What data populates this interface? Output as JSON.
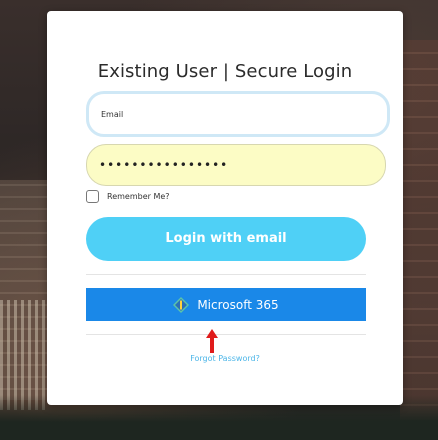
{
  "login": {
    "title": "Existing User | Secure Login",
    "email_placeholder": "Email",
    "password_mask": "••••••••••••••••",
    "remember_label": "Remember Me?",
    "login_button_label": "Login with email",
    "microsoft_button_label": "Microsoft 365",
    "forgot_link_label": "Forgot Password?"
  },
  "colors": {
    "login_button": "#4fd0f6",
    "microsoft_button": "#1a88e8",
    "password_field_bg": "#fcfcc5",
    "link": "#4db6e8",
    "arrow": "#e01b1b"
  },
  "icons": {
    "microsoft": "microsoft-365-icon",
    "annotation": "red-up-arrow-icon"
  }
}
